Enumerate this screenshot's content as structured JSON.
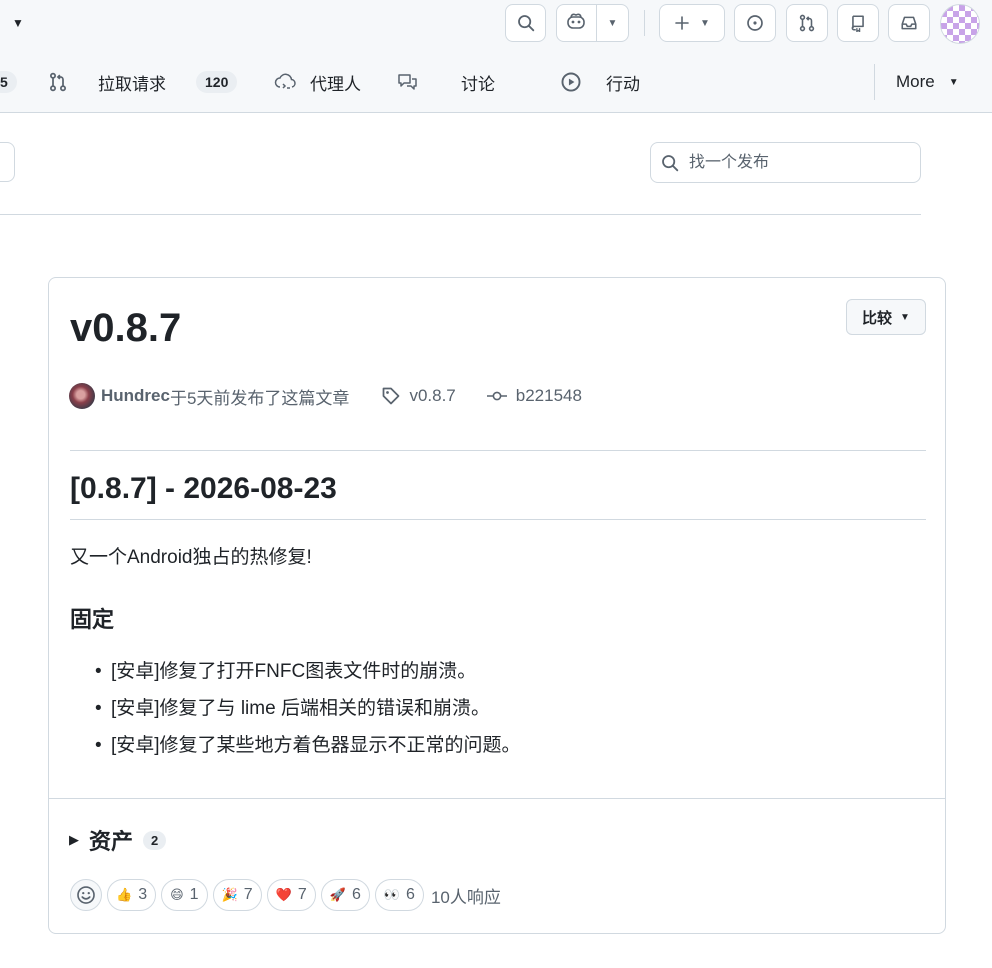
{
  "header": {
    "icons": {
      "search": "search-icon",
      "copilot": "copilot-icon",
      "create": "plus-icon",
      "issues": "issue-opened-icon",
      "pulls": "git-pull-request-icon",
      "repo": "repo-icon",
      "inbox": "inbox-icon"
    }
  },
  "nav": {
    "partial_count": "5",
    "pulls_label": "拉取请求",
    "pulls_count": "120",
    "agents_label": "代理人",
    "discussions_label": "讨论",
    "actions_label": "行动",
    "more_label": "More"
  },
  "search": {
    "placeholder": "找一个发布"
  },
  "release": {
    "title": "v0.8.7",
    "compare_label": "比较",
    "author": "Hundrec",
    "published_text": "于5天前发布了这篇文章",
    "tag": "v0.8.7",
    "commit": "b221548",
    "heading": "[0.8.7] - 2026-08-23",
    "intro": "又一个Android独占的热修复!",
    "section_title": "固定",
    "items": [
      "[安卓]修复了打开FNFC图表文件时的崩溃。",
      "[安卓]修复了与 lime 后端相关的错误和崩溃。",
      "[安卓]修复了某些地方着色器显示不正常的问题。"
    ]
  },
  "assets": {
    "label": "资产",
    "count": "2"
  },
  "reactions": {
    "items": [
      {
        "emoji": "👍",
        "count": "3"
      },
      {
        "emoji": "😄",
        "count": "1"
      },
      {
        "emoji": "🎉",
        "count": "7"
      },
      {
        "emoji": "❤️",
        "count": "7"
      },
      {
        "emoji": "🚀",
        "count": "6"
      },
      {
        "emoji": "👀",
        "count": "6"
      }
    ],
    "summary": "10人响应"
  }
}
